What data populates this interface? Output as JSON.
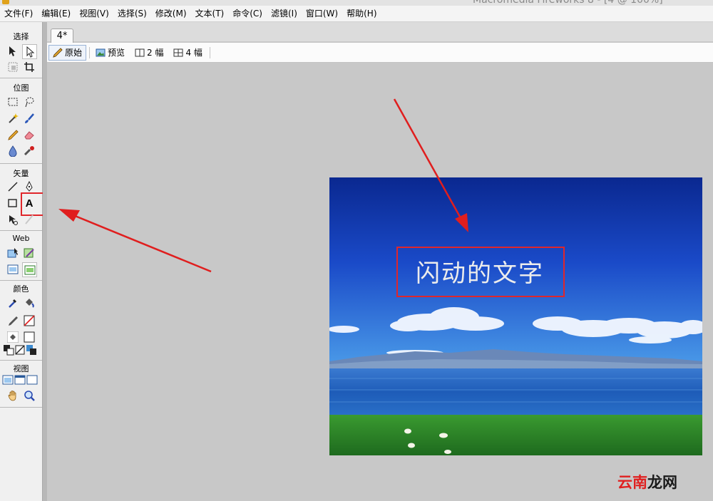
{
  "window": {
    "title": "Macromedia Fireworks 8 - [4 @ 100%]"
  },
  "menu": [
    "文件(F)",
    "编辑(E)",
    "视图(V)",
    "选择(S)",
    "修改(M)",
    "文本(T)",
    "命令(C)",
    "滤镜(I)",
    "窗口(W)",
    "帮助(H)"
  ],
  "tools": {
    "sections": {
      "select": "选择",
      "bitmap": "位图",
      "vector": "矢量",
      "web": "Web",
      "colors": "颜色",
      "view": "视图"
    },
    "text_tool_glyph": "A",
    "highlighted_tool": "text-tool"
  },
  "document": {
    "tab": "4*",
    "view_buttons": [
      "原始",
      "预览",
      "2 幅",
      "4 幅"
    ],
    "active_view": "原始"
  },
  "image": {
    "text": "闪动的文字"
  },
  "watermark": {
    "part1": "云南",
    "part2": "龙网"
  },
  "colors": {
    "highlight": "#e0262b",
    "arrow": "#e01e1e",
    "sky_top": "#0c2ea0",
    "sky_bottom": "#3c8ee8",
    "lake": "#1e64c0",
    "grass": "#2e8a2a"
  }
}
